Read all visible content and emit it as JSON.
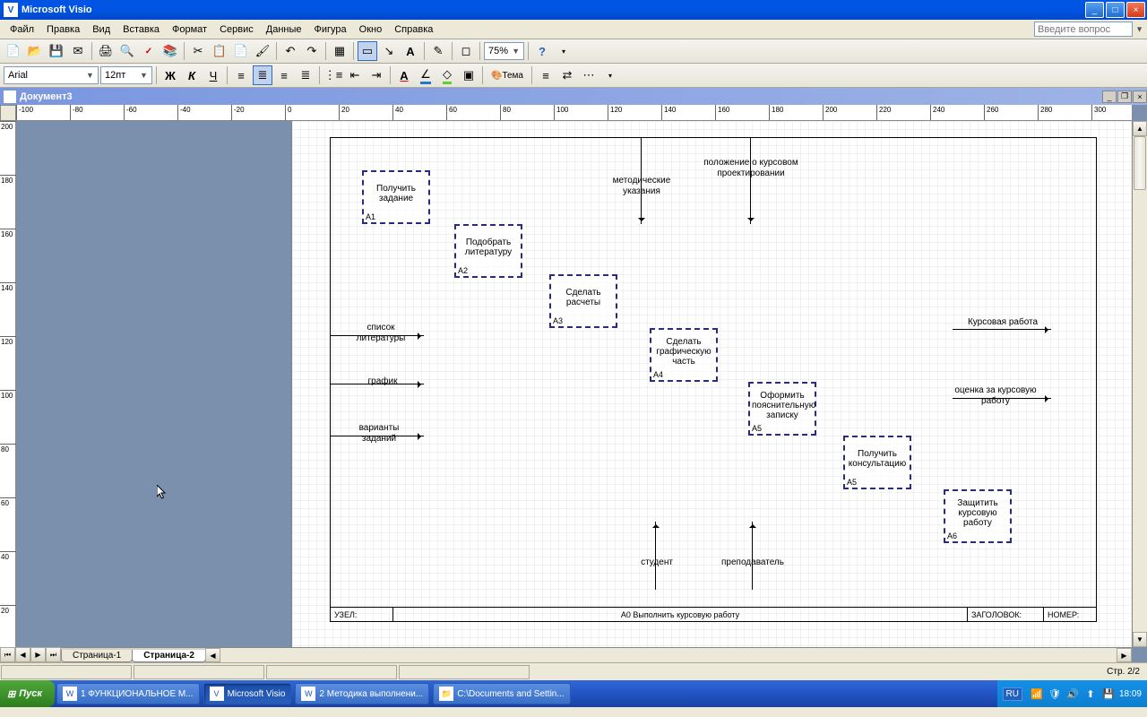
{
  "app": {
    "title": "Microsoft Visio"
  },
  "window_controls": {
    "min": "_",
    "max": "□",
    "close": "×"
  },
  "menus": [
    "Файл",
    "Правка",
    "Вид",
    "Вставка",
    "Формат",
    "Сервис",
    "Данные",
    "Фигура",
    "Окно",
    "Справка"
  ],
  "question_placeholder": "Введите вопрос",
  "toolbar1": {
    "zoom": "75%"
  },
  "toolbar2": {
    "font": "Arial",
    "size": "12пт",
    "theme": "Тема"
  },
  "doc": {
    "title": "Документ3"
  },
  "ruler_h": [
    "-100",
    "-80",
    "-60",
    "-40",
    "-20",
    "0",
    "20",
    "40",
    "60",
    "80",
    "100",
    "120",
    "140",
    "160",
    "180",
    "200",
    "220",
    "240",
    "260",
    "280",
    "300"
  ],
  "ruler_v": [
    "200",
    "180",
    "160",
    "140",
    "120",
    "100",
    "80",
    "60",
    "40",
    "20"
  ],
  "tabs": [
    "Страница-1",
    "Страница-2"
  ],
  "active_tab": 1,
  "blocks": {
    "a1": {
      "id": "A1",
      "text": "Получить задание"
    },
    "a2": {
      "id": "A2",
      "text": "Подобрать литературу"
    },
    "a3": {
      "id": "A3",
      "text": "Сделать расчеты"
    },
    "a4": {
      "id": "A4",
      "text": "Сделать графическую часть"
    },
    "a5": {
      "id": "A5",
      "text": "Оформить пояснительную записку"
    },
    "a5b": {
      "id": "A5",
      "text": "Получить консультацию"
    },
    "a6": {
      "id": "A6",
      "text": "Защитить курсовую работу"
    }
  },
  "labels": {
    "top1": "методические указания",
    "top2": "положение о курсовом проектировании",
    "left1": "список литературы",
    "left2": "график",
    "left3": "варианты заданий",
    "right1": "Курсовая работа",
    "right2": "оценка за курсовую работу",
    "bottom1": "студент",
    "bottom2": "преподаватель"
  },
  "footer": {
    "node_label": "УЗЕЛ:",
    "center": "A0 Выполнить курсовую работу",
    "title_label": "ЗАГОЛОВОК:",
    "num_label": "НОМЕР:"
  },
  "status": {
    "page": "Стр. 2/2"
  },
  "taskbar": {
    "start": "Пуск",
    "items": [
      "1 ФУНКЦИОНАЛЬНОЕ М...",
      "Microsoft Visio",
      "2 Методика выполнени...",
      "C:\\Documents and Settin..."
    ],
    "active": 1,
    "lang": "RU",
    "time": "18:09"
  }
}
